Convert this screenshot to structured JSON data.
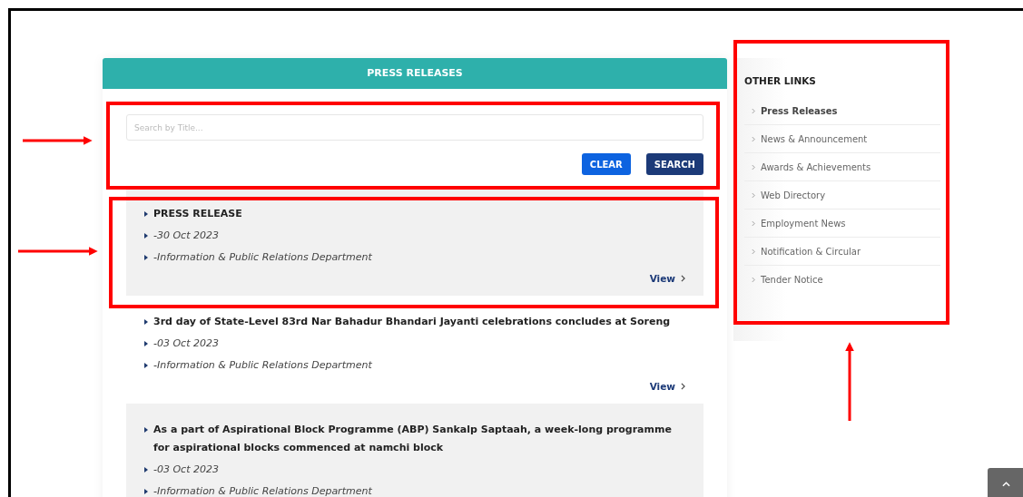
{
  "press_releases": {
    "title": "PRESS RELEASES",
    "search": {
      "placeholder": "Search by Title..."
    },
    "buttons": [
      {
        "label": "CLEAR",
        "kind": "clear"
      },
      {
        "label": "SEARCH",
        "kind": "search"
      }
    ],
    "items": [
      {
        "title": "PRESS RELEASE",
        "date": "-30 Oct 2023",
        "department": "-Information & Public Relations Department",
        "view": "View"
      },
      {
        "title": "3rd day of State-Level 83rd Nar Bahadur Bhandari Jayanti celebrations concludes at Soreng",
        "date": "-03 Oct 2023",
        "department": "-Information & Public Relations Department",
        "view": "View"
      },
      {
        "title": "As a part of Aspirational Block Programme (ABP) Sankalp Saptaah, a week-long programme for aspirational blocks commenced at namchi block",
        "date": "-03 Oct 2023",
        "department": "-Information & Public Relations Department"
      }
    ]
  },
  "other_links": {
    "title": "OTHER LINKS",
    "items": [
      {
        "label": "Press Releases",
        "selected": true
      },
      {
        "label": "News & Announcement",
        "selected": false
      },
      {
        "label": "Awards & Achievements",
        "selected": false
      },
      {
        "label": "Web Directory",
        "selected": false
      },
      {
        "label": "Employment News",
        "selected": false
      },
      {
        "label": "Notification & Circular",
        "selected": false
      },
      {
        "label": "Tender Notice",
        "selected": false
      }
    ]
  }
}
